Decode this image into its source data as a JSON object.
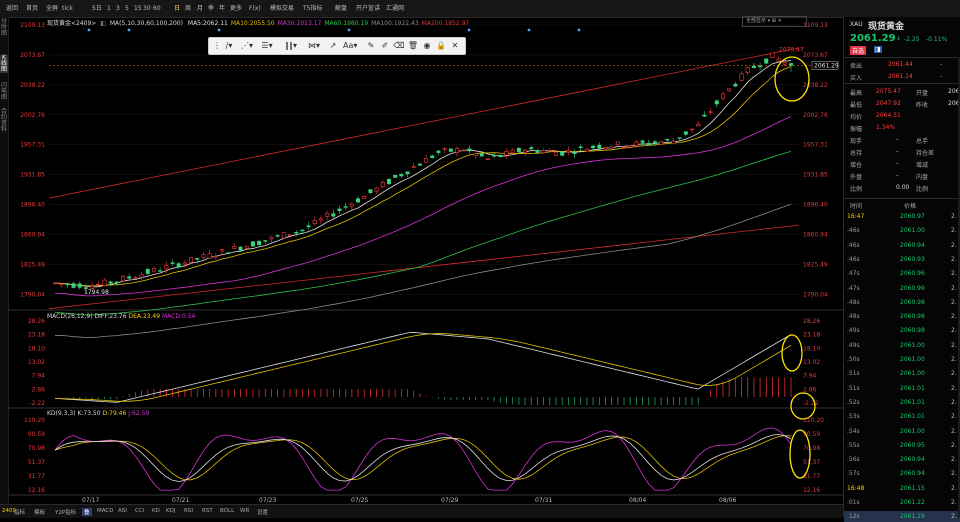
{
  "toolbar": {
    "items": [
      "返回",
      "首页",
      "全屏",
      "tick",
      "5日",
      "1",
      "3",
      "5",
      "15",
      "30",
      "60",
      "日",
      "周",
      "月",
      "季",
      "年",
      "更多",
      "F(x)",
      "模拟交易",
      "T5指标",
      "解盘",
      "开户宣讲",
      "汇通网"
    ],
    "active": "日",
    "date_marker": "2409"
  },
  "left_tabs": [
    "分时图",
    "K线图",
    "闪电图",
    "合约资料"
  ],
  "main": {
    "title": "现货黄金<2409>",
    "ma_spec": "MA(5,10,30,60,100,200)",
    "ma_values": [
      {
        "label": "MA5:",
        "value": "2062.11",
        "color": "#e0e0e0"
      },
      {
        "label": "MA10:",
        "value": "2055.50",
        "color": "#e0c000"
      },
      {
        "label": "MA30:",
        "value": "2013.17",
        "color": "#d733d7"
      },
      {
        "label": "MA60:",
        "value": "1980.19",
        "color": "#2ec24a"
      },
      {
        "label": "MA100:",
        "value": "1922.43",
        "color": "#8a8a8a"
      },
      {
        "label": "MA200:",
        "value": "1852.97",
        "color": "#e03434"
      }
    ],
    "y_ticks": [
      "2109.13",
      "2073.67",
      "2038.22",
      "2002.76",
      "1957.31",
      "1931.85",
      "1896.40",
      "1860.94",
      "1825.49",
      "1790.04"
    ],
    "price_tag": "2061.29",
    "peak_label": "2075.47",
    "low_label": "1794.98"
  },
  "macd": {
    "title": "MACD(26,12,9)",
    "diff": "DIFF:23.76",
    "dea": "DEA:23.49",
    "macd": "MACD:0.54",
    "y_ticks": [
      "28.26",
      "23.18",
      "18.10",
      "13.02",
      "7.94",
      "2.86",
      "-2.22"
    ]
  },
  "kdj": {
    "title": "KD(9,3,3)",
    "k": "K:73.50",
    "d": "D:79.46",
    "j": "J:62.59",
    "y_ticks": [
      "110.20",
      "90.59",
      "70.98",
      "51.37",
      "31.77",
      "12.16"
    ]
  },
  "x_dates": [
    "07/17",
    "07/21",
    "07/23",
    "07/25",
    "07/29",
    "07/31",
    "08/04",
    "08/06"
  ],
  "bottom_bar": {
    "code": "2409",
    "items": [
      "指标",
      "模板",
      "Y2P指标",
      "叠",
      "MACD",
      "ASI",
      "CCI",
      "KD",
      "KDJ",
      "RSI",
      "RST",
      "BOLL",
      "WR",
      "设置"
    ],
    "selected": "叠"
  },
  "panel": {
    "symbol": "XAU",
    "name": "现货黄金",
    "price": "2061.29",
    "arrow": "↓",
    "change": "-2.25",
    "change_pct": "-0.11%",
    "pill": "自选",
    "sell_label": "卖出",
    "sell": "2061.44",
    "sell_x": "-",
    "buy_label": "买入",
    "buy": "2061.14",
    "buy_x": "-",
    "stats": [
      {
        "l1": "最高",
        "v1": "2075.47",
        "l2": "开盘",
        "v2": "206"
      },
      {
        "l1": "最低",
        "v1": "2047.92",
        "l2": "昨收",
        "v2": "206"
      },
      {
        "l1": "均价",
        "v1": "2064.31",
        "l2": "",
        "v2": ""
      },
      {
        "l1": "振幅",
        "v1": "1.34%",
        "l2": "",
        "v2": ""
      }
    ],
    "misc": [
      {
        "l": "现手",
        "v": "-",
        "s": "总手"
      },
      {
        "l": "总持",
        "v": "-",
        "s": "持仓差"
      },
      {
        "l": "增仓",
        "v": "-",
        "s": "增减"
      },
      {
        "l": "外盘",
        "v": "-",
        "s": "内盘"
      },
      {
        "l": "比例",
        "v": "0.00",
        "s": "比例"
      }
    ],
    "head_time": "时间",
    "head_price": "价格",
    "ticks": [
      {
        "t": "16:47",
        "p": "2060.97",
        "v": "2."
      },
      {
        "t": ".46s",
        "p": "2061.00",
        "v": "2."
      },
      {
        "t": ".46s",
        "p": "2060.94",
        "v": "2."
      },
      {
        "t": ".46s",
        "p": "2060.93",
        "v": "2."
      },
      {
        "t": ".47s",
        "p": "2060.96",
        "v": "2."
      },
      {
        "t": ".47s",
        "p": "2060.99",
        "v": "2."
      },
      {
        "t": ".48s",
        "p": "2060.98",
        "v": "2."
      },
      {
        "t": ".48s",
        "p": "2060.98",
        "v": "2."
      },
      {
        "t": ".49s",
        "p": "2060.98",
        "v": "2."
      },
      {
        "t": ".49s",
        "p": "2061.00",
        "v": "2."
      },
      {
        "t": ".50s",
        "p": "2061.00",
        "v": "2."
      },
      {
        "t": ".51s",
        "p": "2061.00",
        "v": "2."
      },
      {
        "t": ".51s",
        "p": "2061.01",
        "v": "2."
      },
      {
        "t": ".52s",
        "p": "2061.01",
        "v": "2."
      },
      {
        "t": ".53s",
        "p": "2061.01",
        "v": "2."
      },
      {
        "t": ".54s",
        "p": "2061.00",
        "v": "2."
      },
      {
        "t": ".55s",
        "p": "2060.95",
        "v": "2."
      },
      {
        "t": ".56s",
        "p": "2060.94",
        "v": "2."
      },
      {
        "t": ".57s",
        "p": "2060.94",
        "v": "2."
      },
      {
        "t": "16:48",
        "p": "2061.15",
        "v": "2."
      },
      {
        "t": ".01s",
        "p": "2061.22",
        "v": "2."
      },
      {
        "t": ".12s",
        "p": "2061.29",
        "v": "2."
      }
    ]
  }
}
